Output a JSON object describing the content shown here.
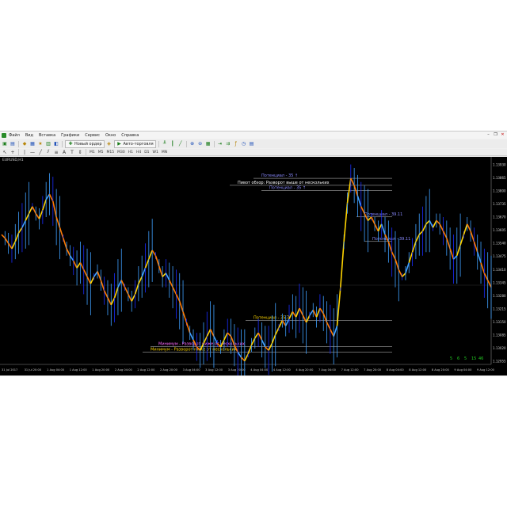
{
  "menu": {
    "items": [
      "Файл",
      "Вид",
      "Вставка",
      "Графики",
      "Сервис",
      "Окно",
      "Справка"
    ]
  },
  "toolbar": {
    "new_order_label": "Новый ордер",
    "autotrading_label": "Авто-торговля",
    "timeframes": [
      "M1",
      "M5",
      "M15",
      "M30",
      "H1",
      "H4",
      "D1",
      "W1",
      "MN"
    ]
  },
  "chart": {
    "symbol": "EURUSD,H1",
    "levels": [
      {
        "label": "Потенциал - 35 ↑",
        "color": "#8a8aff",
        "price": 1.1393
      },
      {
        "label": "Пивот обзор: Разворот выше от нескольких",
        "color": "#ffffff",
        "price": 1.1389
      },
      {
        "label": "Потенциал - 35 ↑",
        "color": "#8a8aff",
        "price": 1.1386
      },
      {
        "label": "Потенциал - 39.11",
        "color": "#8a8aff",
        "price": 1.1371
      },
      {
        "label": "Потенциал - 39.11",
        "color": "#8a8aff",
        "price": 1.1357
      },
      {
        "label": "Потенциал - 35.7",
        "color": "#ffd700",
        "price": 1.1312
      },
      {
        "label": "Минимум - Разворот ниже от нескольких",
        "color": "#ff66ff",
        "price": 1.1297
      },
      {
        "label": "Минимум - Разворот ниже от нескольких",
        "color": "#ffd700",
        "price": 1.1294
      }
    ],
    "price_axis": [
      "1.13930",
      "1.13865",
      "1.13800",
      "1.13735",
      "1.13670",
      "1.13605",
      "1.13540",
      "1.13475",
      "1.13410",
      "1.13345",
      "1.13280",
      "1.13215",
      "1.13150",
      "1.13085",
      "1.13020",
      "1.12955"
    ],
    "time_axis": [
      "31 Jul 2017",
      "31 Jul 20:00",
      "1 Aug 04:00",
      "1 Aug 12:00",
      "1 Aug 20:00",
      "2 Aug 04:00",
      "2 Aug 12:00",
      "2 Aug 20:00",
      "3 Aug 04:00",
      "3 Aug 12:00",
      "3 Aug 20:00",
      "4 Aug 04:00",
      "4 Aug 12:00",
      "4 Aug 20:00",
      "7 Aug 04:00",
      "7 Aug 12:00",
      "7 Aug 20:00",
      "8 Aug 04:00",
      "8 Aug 12:00",
      "8 Aug 20:00",
      "9 Aug 04:00",
      "9 Aug 12:00"
    ],
    "corner_values": [
      "5",
      "6",
      "5",
      "15",
      "46"
    ],
    "colors": {
      "up": "#ffd400",
      "down": "#ff7a00",
      "alt": "#3fa0ff",
      "deep": "#1a2cff"
    }
  },
  "chart_data": {
    "type": "line",
    "x_count": 140,
    "values": [
      1.136,
      1.1358,
      1.1355,
      1.1352,
      1.1356,
      1.1361,
      1.1364,
      1.1368,
      1.1372,
      1.1376,
      1.1372,
      1.1369,
      1.1374,
      1.138,
      1.1383,
      1.1379,
      1.137,
      1.1364,
      1.1358,
      1.1352,
      1.1348,
      1.1345,
      1.1341,
      1.1344,
      1.134,
      1.1336,
      1.1332,
      1.1336,
      1.1339,
      1.1334,
      1.1328,
      1.1324,
      1.132,
      1.1324,
      1.133,
      1.1334,
      1.133,
      1.1326,
      1.1322,
      1.1326,
      1.1332,
      1.1336,
      1.1341,
      1.1346,
      1.1351,
      1.1348,
      1.1342,
      1.1336,
      1.1338,
      1.1334,
      1.133,
      1.1326,
      1.1322,
      1.1316,
      1.131,
      1.1304,
      1.13,
      1.1296,
      1.1294,
      1.1298,
      1.1302,
      1.1306,
      1.1302,
      1.1298,
      1.1296,
      1.13,
      1.1304,
      1.1302,
      1.1297,
      1.1293,
      1.129,
      1.1288,
      1.1292,
      1.1297,
      1.1301,
      1.1304,
      1.13,
      1.1296,
      1.1294,
      1.1298,
      1.1303,
      1.1307,
      1.1311,
      1.1308,
      1.1312,
      1.1316,
      1.1313,
      1.1318,
      1.1314,
      1.131,
      1.1314,
      1.1317,
      1.1313,
      1.1318,
      1.1315,
      1.131,
      1.1306,
      1.1302,
      1.1308,
      1.133,
      1.1356,
      1.1378,
      1.1392,
      1.1388,
      1.1382,
      1.1376,
      1.1372,
      1.1368,
      1.137,
      1.1366,
      1.1362,
      1.1366,
      1.136,
      1.1356,
      1.135,
      1.1346,
      1.134,
      1.1336,
      1.1338,
      1.1344,
      1.135,
      1.1356,
      1.136,
      1.1362,
      1.1366,
      1.1368,
      1.1364,
      1.1368,
      1.1366,
      1.1362,
      1.1358,
      1.1352,
      1.1346,
      1.1348,
      1.1354,
      1.136,
      1.1366,
      1.1362,
      1.1356,
      1.135,
      1.1344,
      1.1338,
      1.1334,
      1.133
    ],
    "ylim": [
      1.1286,
      1.1398
    ]
  }
}
